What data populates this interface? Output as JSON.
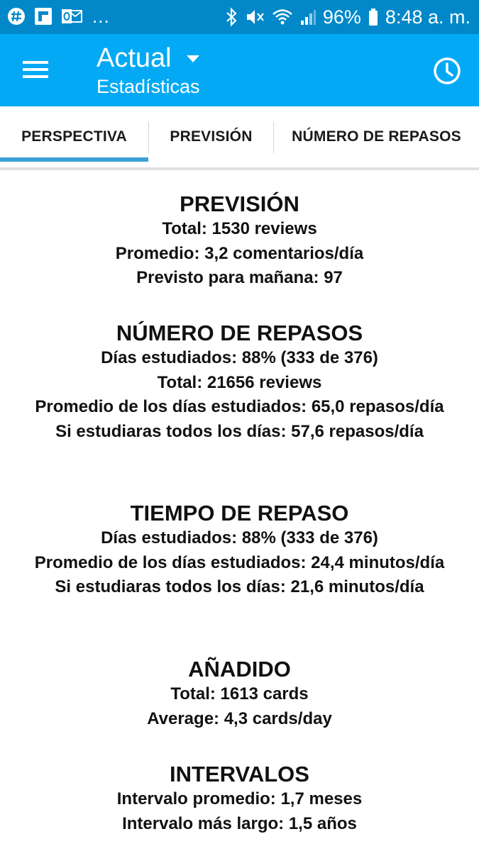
{
  "status_bar": {
    "left_icons": [
      "slack-icon",
      "flipboard-icon",
      "outlook-icon"
    ],
    "overflow": "...",
    "battery": "96%",
    "time": "8:48 a. m."
  },
  "app_bar": {
    "title": "Actual",
    "subtitle": "Estadísticas",
    "color": "#03a9f4"
  },
  "tabs": [
    {
      "label": "PERSPECTIVA",
      "selected": true
    },
    {
      "label": "PREVISIÓN",
      "selected": false
    },
    {
      "label": "NÚMERO DE REPASOS",
      "selected": false
    }
  ],
  "stats": {
    "forecast": {
      "title": "PREVISIÓN",
      "lines": [
        "Total: 1530 reviews",
        "Promedio: 3,2 comentarios/día",
        "Previsto para mañana: 97"
      ]
    },
    "review_count": {
      "title": "NÚMERO DE REPASOS",
      "lines": [
        "Días estudiados: 88% (333 de 376)",
        "Total: 21656 reviews",
        "Promedio de los días estudiados: 65,0 repasos/día",
        "Si estudiaras todos los días: 57,6 repasos/día"
      ]
    },
    "review_time": {
      "title": "TIEMPO DE REPASO",
      "lines": [
        "Días estudiados: 88% (333 de 376)",
        "Promedio de los días estudiados: 24,4 minutos/día",
        "Si estudiaras todos los días: 21,6 minutos/día"
      ]
    },
    "added": {
      "title": "AÑADIDO",
      "lines": [
        "Total: 1613 cards",
        "Average: 4,3 cards/day"
      ]
    },
    "intervals": {
      "title": "INTERVALOS",
      "lines": [
        "Intervalo promedio: 1,7 meses",
        "Intervalo más largo: 1,5 años"
      ]
    }
  }
}
